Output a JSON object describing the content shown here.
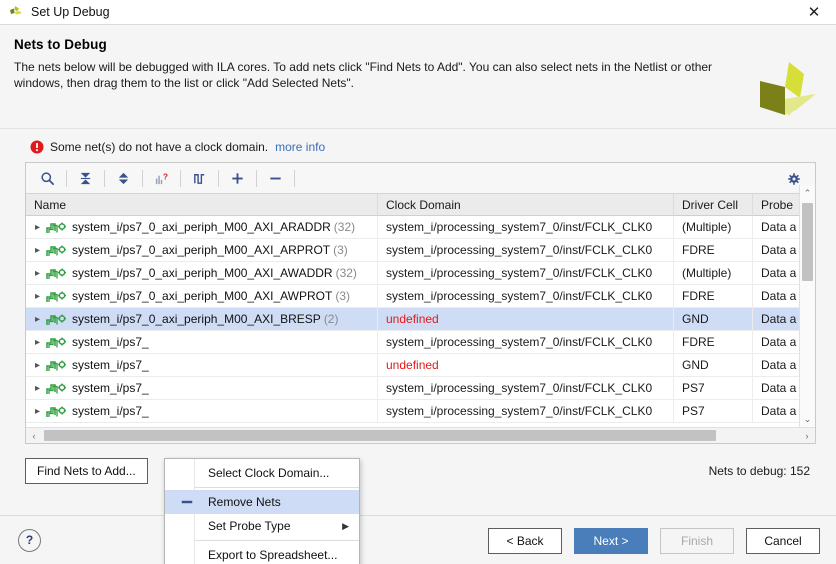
{
  "titlebar": {
    "title": "Set Up Debug",
    "logo_icon": "vivado-logo-icon",
    "close_icon": "close-icon",
    "close_label": "✕"
  },
  "header": {
    "title": "Nets to Debug",
    "description": "The nets below will be debugged with ILA cores. To add nets click \"Find Nets to Add\". You can also select nets in the Netlist or other windows, then drag them to the list or click \"Add Selected Nets\".",
    "logo_icon": "xilinx-logo-icon"
  },
  "warning": {
    "icon": "error-icon",
    "text": "Some net(s) do not have a clock domain.",
    "link": "more info"
  },
  "toolbar": {
    "buttons": [
      {
        "name": "search-icon",
        "title": "Search"
      },
      {
        "name": "collapse-all-icon",
        "title": "Collapse All"
      },
      {
        "name": "expand-all-icon",
        "title": "Expand All"
      },
      {
        "name": "unassigned-clock-icon",
        "title": "Show Unassigned Clock Domain"
      },
      {
        "name": "clock-domain-icon",
        "title": "Clock Domain"
      },
      {
        "name": "add-nets-icon",
        "title": "Add Nets"
      },
      {
        "name": "remove-nets-icon",
        "title": "Remove Nets"
      }
    ],
    "settings_icon": "gear-icon"
  },
  "table": {
    "columns": [
      {
        "key": "name",
        "label": "Name"
      },
      {
        "key": "clock",
        "label": "Clock Domain"
      },
      {
        "key": "driver",
        "label": "Driver Cell"
      },
      {
        "key": "probe",
        "label": "Probe"
      }
    ],
    "rows": [
      {
        "name": "system_i/ps7_0_axi_periph_M00_AXI_ARADDR",
        "count": "(32)",
        "clock": "system_i/processing_system7_0/inst/FCLK_CLK0",
        "clock_undefined": false,
        "driver": "(Multiple)",
        "probe": "Data a",
        "selected": false
      },
      {
        "name": "system_i/ps7_0_axi_periph_M00_AXI_ARPROT",
        "count": "(3)",
        "clock": "system_i/processing_system7_0/inst/FCLK_CLK0",
        "clock_undefined": false,
        "driver": "FDRE",
        "probe": "Data a",
        "selected": false
      },
      {
        "name": "system_i/ps7_0_axi_periph_M00_AXI_AWADDR",
        "count": "(32)",
        "clock": "system_i/processing_system7_0/inst/FCLK_CLK0",
        "clock_undefined": false,
        "driver": "(Multiple)",
        "probe": "Data a",
        "selected": false
      },
      {
        "name": "system_i/ps7_0_axi_periph_M00_AXI_AWPROT",
        "count": "(3)",
        "clock": "system_i/processing_system7_0/inst/FCLK_CLK0",
        "clock_undefined": false,
        "driver": "FDRE",
        "probe": "Data a",
        "selected": false
      },
      {
        "name": "system_i/ps7_0_axi_periph_M00_AXI_BRESP",
        "count": "(2)",
        "clock": "undefined",
        "clock_undefined": true,
        "driver": "GND",
        "probe": "Data a",
        "selected": true
      },
      {
        "name": "system_i/ps7_",
        "count": "",
        "clock": "system_i/processing_system7_0/inst/FCLK_CLK0",
        "clock_undefined": false,
        "driver": "FDRE",
        "probe": "Data a",
        "selected": false
      },
      {
        "name": "system_i/ps7_",
        "count": "",
        "clock": "undefined",
        "clock_undefined": true,
        "driver": "GND",
        "probe": "Data a",
        "selected": false
      },
      {
        "name": "system_i/ps7_",
        "count": "",
        "clock": "system_i/processing_system7_0/inst/FCLK_CLK0",
        "clock_undefined": false,
        "driver": "PS7",
        "probe": "Data a",
        "selected": false
      },
      {
        "name": "system_i/ps7_",
        "count": "",
        "clock": "system_i/processing_system7_0/inst/FCLK_CLK0",
        "clock_undefined": false,
        "driver": "PS7",
        "probe": "Data a",
        "selected": false
      }
    ],
    "row_icon": "net-signal-icon",
    "expand_icon": "chevron-right-icon"
  },
  "context_menu": {
    "items": [
      {
        "label": "Select Clock Domain...",
        "icon": "",
        "highlighted": false,
        "submenu": false,
        "separator_after": true
      },
      {
        "label": "Remove Nets",
        "icon": "remove-nets-icon",
        "highlighted": true,
        "submenu": false,
        "separator_after": false
      },
      {
        "label": "Set Probe Type",
        "icon": "",
        "highlighted": false,
        "submenu": true,
        "separator_after": true
      },
      {
        "label": "Export to Spreadsheet...",
        "icon": "",
        "highlighted": false,
        "submenu": false,
        "separator_after": false
      }
    ],
    "submenu_arrow": "▶"
  },
  "below": {
    "find_nets_button": "Find Nets to Add...",
    "find_nets_mnemonic": "A",
    "nets_to_debug_label": "Nets to debug: 152"
  },
  "scrollbars": {
    "v_up": "⌃",
    "v_down": "⌄",
    "h_left": "‹",
    "h_right": "›"
  },
  "footer": {
    "help_label": "?",
    "back_label": "< Back",
    "back_mnemonic": "B",
    "next_label": "Next >",
    "next_mnemonic": "N",
    "finish_label": "Finish",
    "finish_mnemonic": "F",
    "cancel_label": "Cancel"
  },
  "colors": {
    "accent": "#4a7ebb",
    "selection": "#cfdcf5",
    "error": "#e01b1b",
    "link": "#3a6fb5",
    "logo_dark": "#7b8018",
    "logo_mid": "#d6de3a",
    "logo_light": "#e3e98a"
  }
}
